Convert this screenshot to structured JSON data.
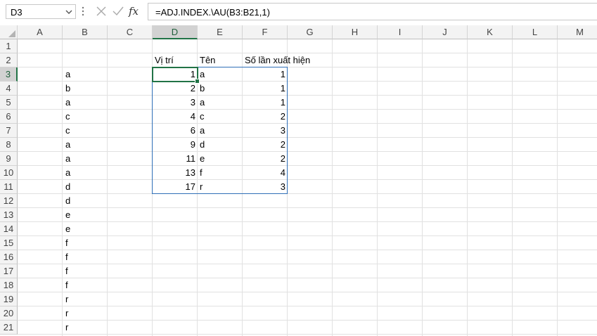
{
  "formula_bar": {
    "name_box": "D3",
    "formula": "=ADJ.INDEX.\\AU(B3:B21,1)",
    "fx_label": "fx"
  },
  "columns": [
    "A",
    "B",
    "C",
    "D",
    "E",
    "F",
    "G",
    "H",
    "I",
    "J",
    "K",
    "L",
    "M"
  ],
  "rows": [
    "1",
    "2",
    "3",
    "4",
    "5",
    "6",
    "7",
    "8",
    "9",
    "10",
    "11",
    "12",
    "13",
    "14",
    "15",
    "16",
    "17",
    "18",
    "19",
    "20",
    "21"
  ],
  "selected_cell": "D3",
  "headers_row2": {
    "D": "Vị trí",
    "E": "Tên",
    "F": "Số lần xuất hiện"
  },
  "column_b": [
    "a",
    "b",
    "a",
    "c",
    "c",
    "a",
    "a",
    "a",
    "d",
    "d",
    "e",
    "e",
    "f",
    "f",
    "f",
    "f",
    "r",
    "r",
    "r"
  ],
  "column_d": [
    "1",
    "2",
    "3",
    "4",
    "6",
    "9",
    "11",
    "13",
    "17"
  ],
  "column_e": [
    "a",
    "b",
    "a",
    "c",
    "a",
    "d",
    "e",
    "f",
    "r"
  ],
  "column_f": [
    "1",
    "1",
    "1",
    "2",
    "3",
    "2",
    "2",
    "4",
    "3"
  ],
  "icons": {
    "cancel": "x-icon",
    "enter": "check-icon",
    "function": "fx-icon"
  }
}
